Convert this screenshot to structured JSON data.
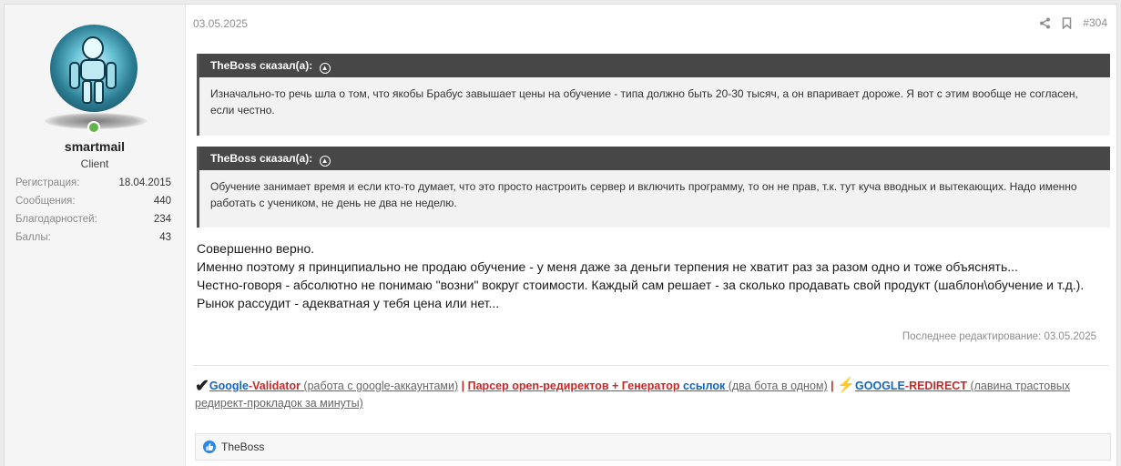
{
  "user": {
    "name": "smartmail",
    "title": "Client",
    "stats": [
      {
        "label": "Регистрация:",
        "value": "18.04.2015"
      },
      {
        "label": "Сообщения:",
        "value": "440"
      },
      {
        "label": "Благодарностей:",
        "value": "234"
      },
      {
        "label": "Баллы:",
        "value": "43"
      }
    ]
  },
  "post": {
    "date": "03.05.2025",
    "number": "#304",
    "quotes": [
      {
        "author": "TheBoss сказал(а):",
        "text": "Изначально-то речь шла о том, что якобы Брабус завышает цены на обучение - типа должно быть 20-30 тысяч, а он впаривает дороже. Я вот с этим вообще не согласен, если честно."
      },
      {
        "author": "TheBoss сказал(а):",
        "text": "Обучение занимает время и если кто-то думает, что это просто настроить сервер и включить программу, то он не прав, т.к. тут куча вводных и вытекающих. Надо именно работать с учеником, не день не два не неделю."
      }
    ],
    "lines": [
      "Совершенно верно.",
      "Именно поэтому я принципиально не продаю обучение - у меня даже за деньги терпения не хватит раз за разом одно и тоже объяснять...",
      "Честно-говоря - абсолютно не понимаю \"возни\" вокруг стоимости. Каждый сам решает - за сколько продавать свой продукт (шаблон\\обучение и т.д.). Рынок рассудит - адекватная у тебя цена или нет..."
    ],
    "edited": "Последнее редактирование: 03.05.2025"
  },
  "signature": {
    "check": "✔",
    "link1_a": "Google",
    "link1_b": "-Validator",
    "desc1": " (работа с google-аккаунтами)",
    "sep": " | ",
    "link2_a": "Парсер open-редиректов + Генератор ",
    "link2_b": "ссылок",
    "desc2": " (два бота в одном)",
    "bolt": "⚡",
    "link3_a": "GOOGLE",
    "link3_b": "-REDIRECT",
    "desc3": " (лавина трастовых редирект-прокладок за минуты)"
  },
  "reactions": {
    "name": "TheBoss"
  }
}
